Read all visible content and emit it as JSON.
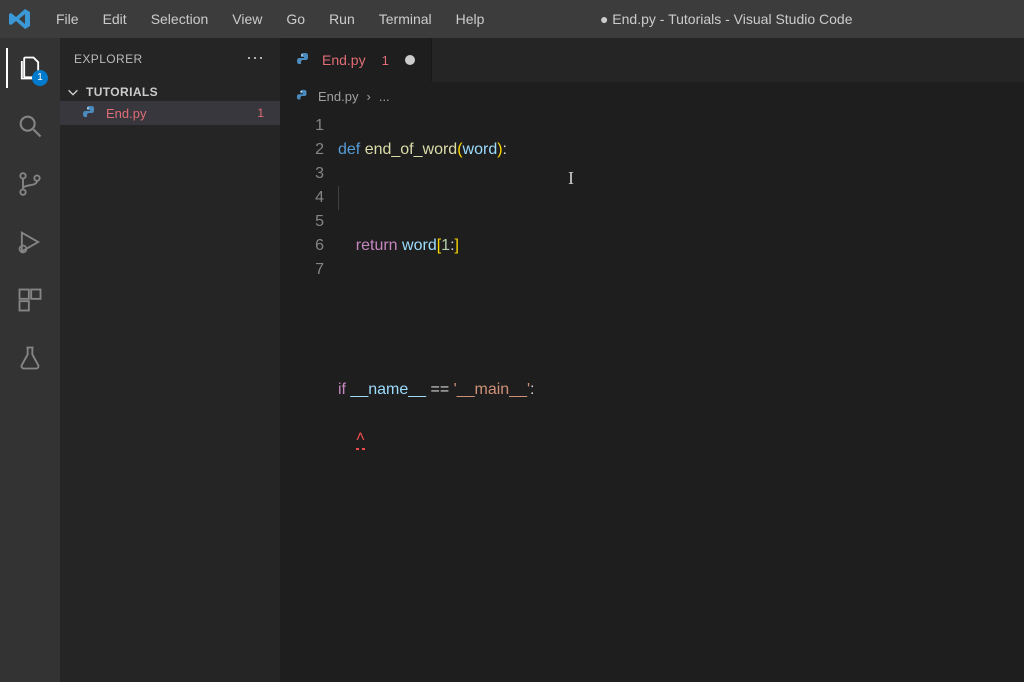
{
  "title": "● End.py - Tutorials - Visual Studio Code",
  "menu": [
    "File",
    "Edit",
    "Selection",
    "View",
    "Go",
    "Run",
    "Terminal",
    "Help"
  ],
  "activity": {
    "explorer_badge": "1"
  },
  "sidebar": {
    "title": "EXPLORER",
    "more": "⋯",
    "folder": "TUTORIALS",
    "file": {
      "name": "End.py",
      "problems": "1"
    }
  },
  "tab": {
    "name": "End.py",
    "problems": "1"
  },
  "breadcrumb": {
    "file": "End.py",
    "sep": "›",
    "rest": "..."
  },
  "code": {
    "lineNumbers": [
      "1",
      "2",
      "3",
      "4",
      "5",
      "6",
      "7"
    ],
    "l1": {
      "def": "def ",
      "fn": "end_of_word",
      "lp": "(",
      "arg": "word",
      "rp": ")",
      "colon": ":"
    },
    "l3": {
      "ret": "return ",
      "id": "word",
      "lb": "[",
      "one": "1",
      "colon": ":",
      "rb": "]"
    },
    "l6": {
      "if": "if ",
      "name": "__name__",
      "eq": " == ",
      "str": "'__main__'",
      "colon": ":"
    },
    "l7": {
      "err": "˄"
    }
  }
}
